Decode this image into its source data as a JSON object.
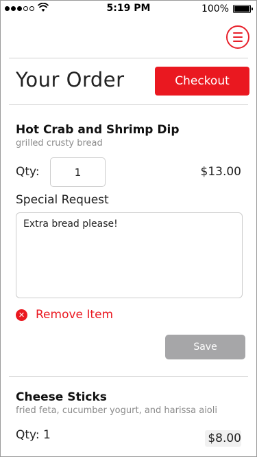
{
  "status_bar": {
    "time": "5:19 PM",
    "battery": "100%",
    "signal_dots_filled": 3,
    "signal_dots_total": 5
  },
  "header": {
    "menu_icon": "hamburger-icon",
    "title": "Your Order",
    "checkout_label": "Checkout"
  },
  "items": [
    {
      "name": "Hot Crab and Shrimp Dip",
      "description": "grilled crusty bread",
      "qty_label": "Qty:",
      "qty_value": "1",
      "price": "$13.00",
      "special_request_label": "Special Request",
      "special_request_value": "Extra bread please!",
      "remove_label": "Remove Item",
      "save_label": "Save"
    },
    {
      "name": "Cheese Sticks",
      "description": "fried feta, cucumber yogurt, and harissa aioli",
      "qty_label": "Qty: 1",
      "price": "$8.00"
    }
  ],
  "colors": {
    "accent": "#ea1820",
    "disabled": "#a6a6a8",
    "muted_text": "#8a8a8a"
  }
}
